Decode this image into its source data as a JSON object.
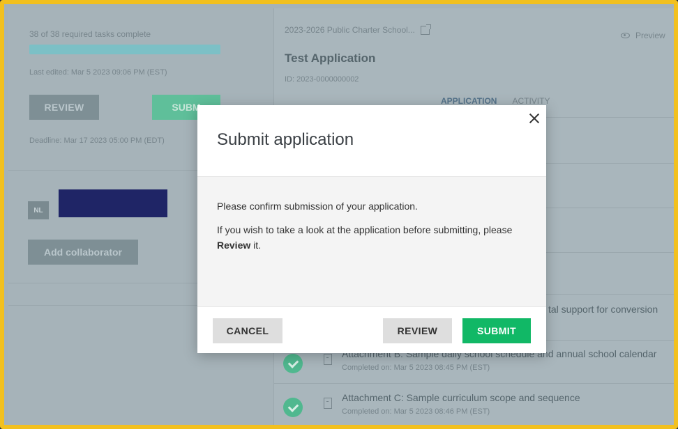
{
  "sidebar": {
    "tasks_status": "38 of 38 required tasks complete",
    "progress_percent": 100,
    "last_edited": "Last edited: Mar 5 2023 09:06 PM (EST)",
    "review_label": "REVIEW",
    "submit_label": "SUBM",
    "deadline": "Deadline: Mar 17 2023 05:00 PM (EDT)",
    "avatar_initials": "NL",
    "add_collaborator_label": "Add collaborator"
  },
  "main": {
    "breadcrumb": "2023-2026 Public Charter School...",
    "preview_label": "Preview",
    "title": "Test Application",
    "app_id": "ID: 2023-0000000002",
    "tabs": [
      {
        "label": "APPLICATION"
      },
      {
        "label": "ACTIVITY"
      }
    ],
    "partial_item_text": "tal support for conversion",
    "items": [
      {
        "title": "Attachment B: Sample daily school schedule and annual school calendar",
        "completed": "Completed on: Mar 5 2023 08:45 PM (EST)"
      },
      {
        "title": "Attachment C: Sample curriculum scope and sequence",
        "completed": "Completed on: Mar 5 2023 08:46 PM (EST)"
      }
    ]
  },
  "modal": {
    "title": "Submit application",
    "line1": "Please confirm submission of your application.",
    "line2_prefix": "If you wish to take a look at the application before submitting, please ",
    "line2_bold": "Review",
    "line2_suffix": " it.",
    "cancel_label": "CANCEL",
    "review_label": "REVIEW",
    "submit_label": "SUBMIT"
  },
  "colors": {
    "frame_border": "#f2c01e",
    "submit_green": "#11b866",
    "overlay": "#a5b2b8"
  }
}
